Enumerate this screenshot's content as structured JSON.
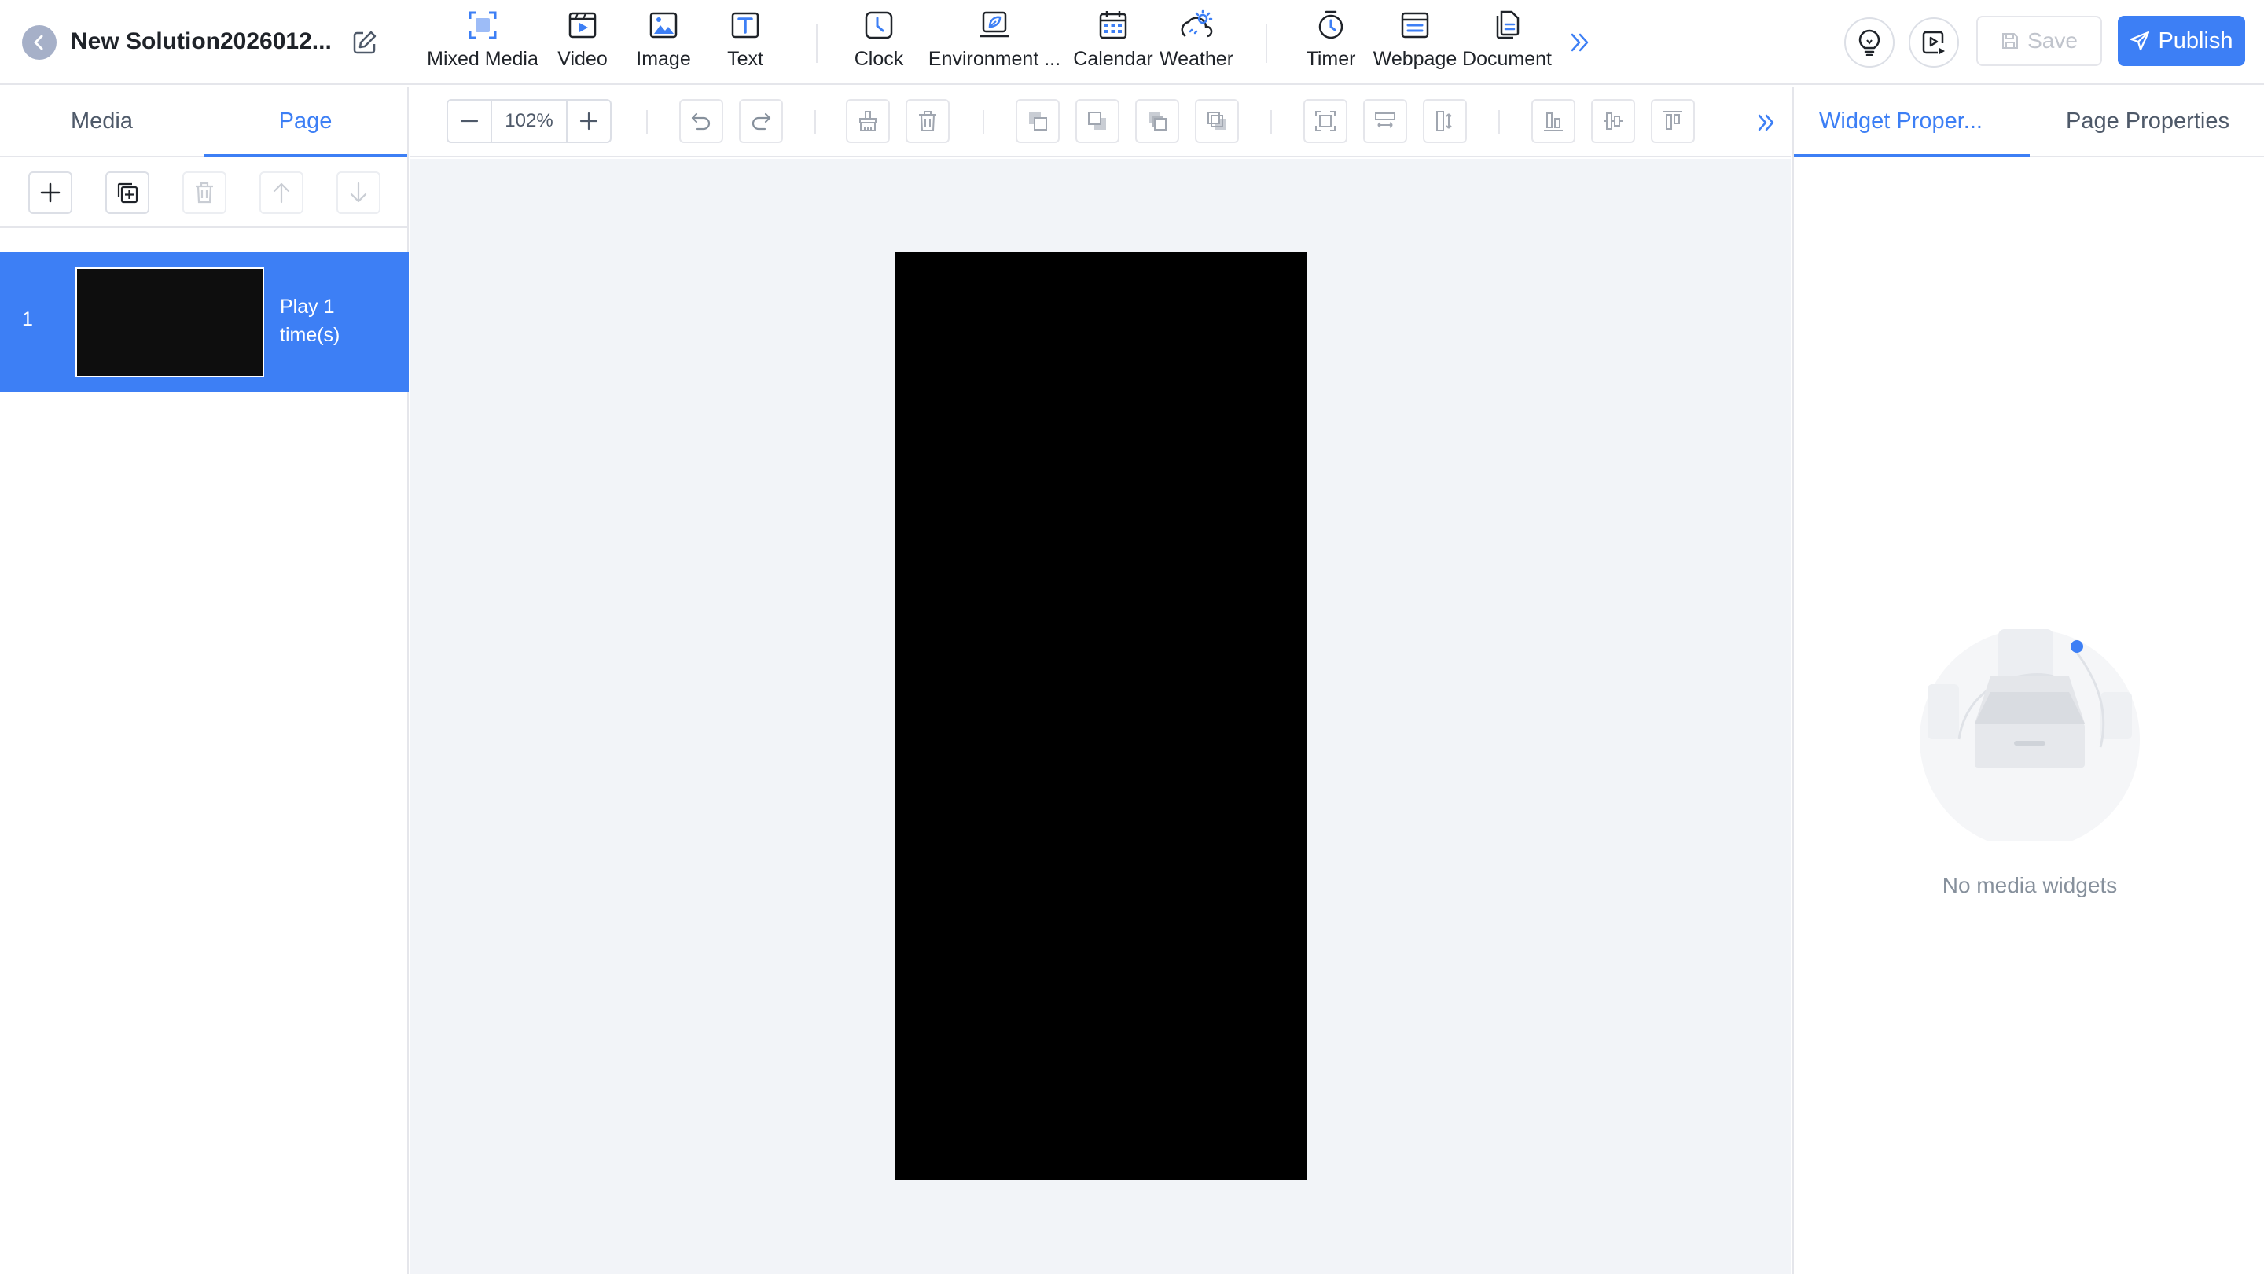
{
  "header": {
    "title": "New Solution2026012...",
    "tools": [
      {
        "label": "Mixed Media",
        "icon": "mixed-media-icon"
      },
      {
        "label": "Video",
        "icon": "video-icon"
      },
      {
        "label": "Image",
        "icon": "image-icon"
      },
      {
        "label": "Text",
        "icon": "text-icon"
      },
      {
        "label": "Clock",
        "icon": "clock-icon"
      },
      {
        "label": "Environment ...",
        "icon": "environment-icon"
      },
      {
        "label": "Calendar",
        "icon": "calendar-icon"
      },
      {
        "label": "Weather",
        "icon": "weather-icon"
      },
      {
        "label": "Timer",
        "icon": "timer-icon"
      },
      {
        "label": "Webpage",
        "icon": "webpage-icon"
      },
      {
        "label": "Document",
        "icon": "document-icon"
      }
    ],
    "save_label": "Save",
    "publish_label": "Publish"
  },
  "left_panel": {
    "tabs": [
      "Media",
      "Page"
    ],
    "active_tab": "Page",
    "pages": [
      {
        "number": "1",
        "play_text": "Play  1 time(s)"
      }
    ]
  },
  "editor_toolbar": {
    "zoom": "102%"
  },
  "right_panel": {
    "tabs": [
      "Widget Proper...",
      "Page Properties"
    ],
    "active_tab": "Widget Proper...",
    "empty_text": "No media widgets"
  },
  "colors": {
    "accent": "#3d7ff5",
    "canvas_bg": "#f2f4f8",
    "stage_bg": "#000000"
  }
}
